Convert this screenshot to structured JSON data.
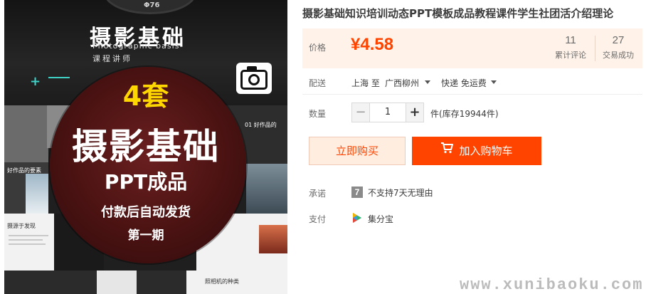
{
  "gallery": {
    "lens_text": "Φ76",
    "title": "摄影基础",
    "subtitle_en": "Photographic basis",
    "subtitle_cn": "课程讲师",
    "plus": "+",
    "badge_count": "4套",
    "badge_main": "摄影基础",
    "badge_ppt": "PPT成品",
    "badge_auto": "付款后自动发货",
    "badge_phase": "第一期",
    "tile_texts": [
      "01 好作品",
      "01 好作品的",
      "好作品的要素",
      "摄源于发现",
      "照相机的种类"
    ]
  },
  "product": {
    "title": "摄影基础知识培训动态PPT模板成品教程课件学生社团活介绍理论"
  },
  "price": {
    "label": "价格",
    "value": "¥4.58",
    "reviews_count": "11",
    "reviews_label": "累计评论",
    "deals_count": "27",
    "deals_label": "交易成功"
  },
  "shipping": {
    "label": "配送",
    "from": "上海 至",
    "to": "广西柳州",
    "method": "快递 免运费"
  },
  "quantity": {
    "label": "数量",
    "minus": "−",
    "value": "1",
    "plus": "+",
    "stock": "件(库存19944件)"
  },
  "actions": {
    "buy_now": "立即购买",
    "add_to_cart": "加入购物车"
  },
  "promise": {
    "label": "承诺",
    "icon_text": "7",
    "text": "不支持7天无理由"
  },
  "payment": {
    "label": "支付",
    "text": "集分宝"
  },
  "watermark": "www.xunibaoku.com",
  "colors": {
    "accent": "#ff4400",
    "price_bg": "#fff2e8",
    "badge_yellow": "#ffd700"
  }
}
